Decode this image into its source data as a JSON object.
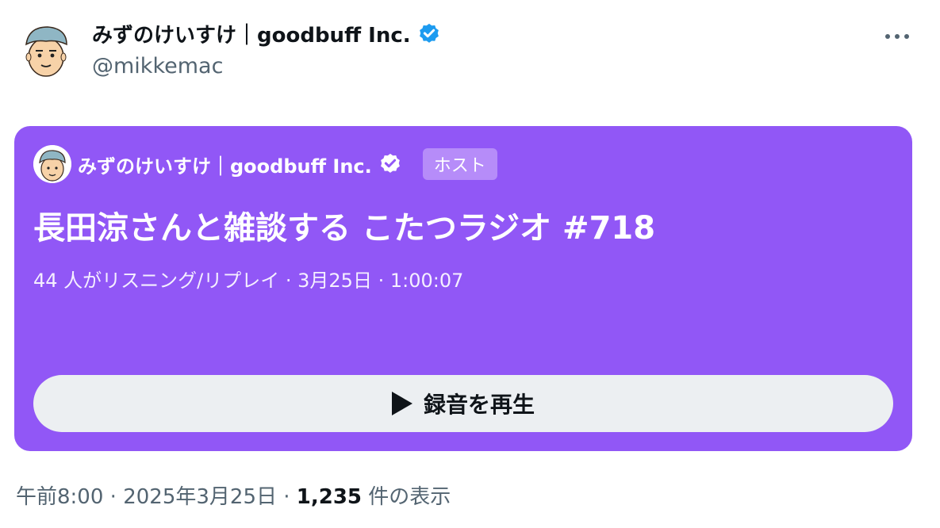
{
  "author": {
    "name": "みずのけいすけ｜goodbuff Inc.",
    "handle": "@mikkemac",
    "avatar_icon": "cartoon-avatar-icon",
    "verified_icon": "verified-badge-icon"
  },
  "space": {
    "host_name": "みずのけいすけ｜goodbuff Inc.",
    "host_badge": "ホスト",
    "title": "長田涼さんと雑談する こたつラジオ #718",
    "meta": "44 人がリスニング/リプレイ · 3月25日 · 1:00:07",
    "play_label": "録音を再生",
    "card_color": "#9157f6"
  },
  "footer": {
    "time": "午前8:00",
    "date": "2025年3月25日",
    "views_count": "1,235",
    "views_label": "件の表示"
  },
  "colors": {
    "accent": "#1d9bf0",
    "muted_text": "#536471"
  }
}
